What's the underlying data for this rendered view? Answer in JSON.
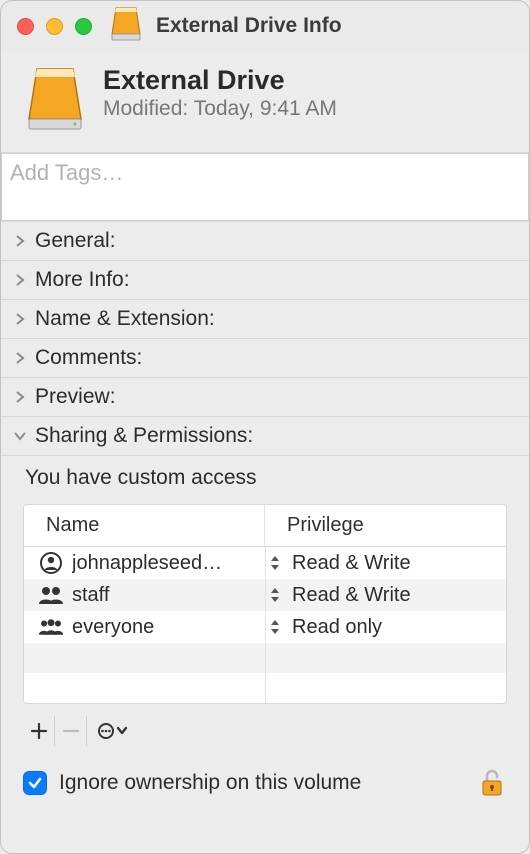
{
  "window": {
    "title": "External Drive Info"
  },
  "header": {
    "name": "External Drive",
    "modified_label": "Modified:",
    "modified_value": "Today, 9:41 AM"
  },
  "tags": {
    "placeholder": "Add Tags…"
  },
  "sections": {
    "general": "General:",
    "more_info": "More Info:",
    "name_ext": "Name & Extension:",
    "comments": "Comments:",
    "preview": "Preview:",
    "sharing": "Sharing & Permissions:"
  },
  "sharing": {
    "access_text": "You have custom access",
    "columns": {
      "name": "Name",
      "privilege": "Privilege"
    },
    "rows": [
      {
        "icon": "person",
        "name": "johnappleseed…",
        "privilege": "Read & Write"
      },
      {
        "icon": "group",
        "name": "staff",
        "privilege": "Read & Write"
      },
      {
        "icon": "group",
        "name": "everyone",
        "privilege": "Read only"
      }
    ],
    "ignore_ownership_label": "Ignore ownership on this volume",
    "ignore_ownership_checked": true
  }
}
